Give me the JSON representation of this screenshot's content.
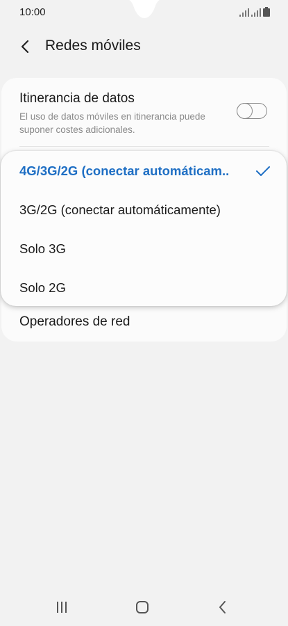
{
  "status_bar": {
    "time": "10:00"
  },
  "header": {
    "title": "Redes móviles"
  },
  "roaming": {
    "title": "Itinerancia de datos",
    "description": "El uso de datos móviles en itinerancia puede suponer costes adicionales.",
    "toggle_on": false
  },
  "network_mode_options": [
    {
      "label": "4G/3G/2G (conectar automáticam..",
      "selected": true
    },
    {
      "label": "3G/2G (conectar automáticamente)",
      "selected": false
    },
    {
      "label": "Solo 3G",
      "selected": false
    },
    {
      "label": "Solo 2G",
      "selected": false
    }
  ],
  "operators": {
    "label": "Operadores de red"
  },
  "colors": {
    "accent": "#1f6fc4",
    "background": "#f2f2f2",
    "card": "#fbfbfb"
  }
}
